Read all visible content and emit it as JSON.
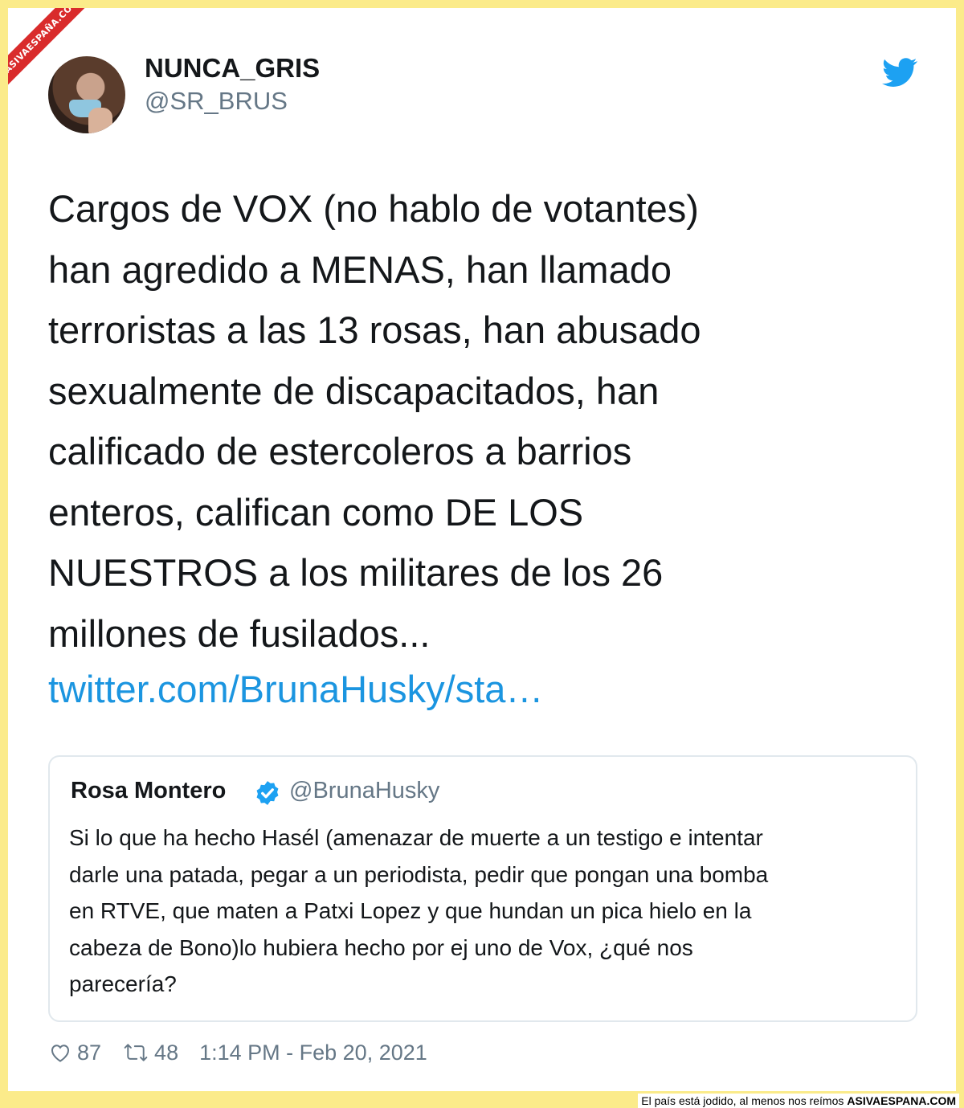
{
  "watermark": {
    "corner_ribbon": "ASIVAESPAÑA.COM"
  },
  "tweet": {
    "display_name": "NUNCA_GRIS",
    "handle": "@SR_BRUS",
    "text": "Cargos de VOX (no hablo de votantes)\nhan agredido a MENAS, han llamado\nterroristas a las 13 rosas, han abusado\nsexualmente de discapacitados, han\ncalificado de estercoleros a barrios\nenteros, califican como DE LOS\nNUESTROS a los militares de los 26\nmillones de fusilados...",
    "link": "twitter.com/BrunaHusky/sta…",
    "bird_icon": "twitter-bird-icon",
    "likes": "87",
    "retweets": "48",
    "timestamp": "1:14 PM - Feb 20, 2021"
  },
  "quoted_tweet": {
    "display_name": "Rosa Montero",
    "verified_icon": "verified-badge-icon",
    "handle": "@BrunaHusky",
    "text": "Si lo que ha hecho Hasél (amenazar de muerte a un testigo e intentar\ndarle una patada, pegar a un periodista, pedir que pongan una bomba\nen RTVE, que maten a Patxi Lopez y que hundan un pica hielo en la\ncabeza de Bono)lo hubiera hecho por ej uno de Vox, ¿qué nos\nparecería?"
  },
  "caption": {
    "text": "El país está jodido, al menos nos reímos",
    "site": "ASIVAESPANA.COM"
  },
  "colors": {
    "background": "#fbeb8a",
    "link": "#1b95e0",
    "twitter_blue": "#1da1f2",
    "secondary_text": "#657786"
  }
}
